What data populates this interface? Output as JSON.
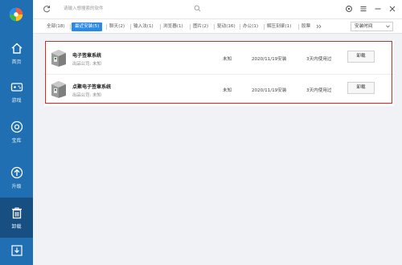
{
  "colors": {
    "sidebar": "#1f6fb2",
    "sidebar_active": "#174f82",
    "accent": "#2b8ae6",
    "highlight": "#e02424"
  },
  "sidebar": {
    "items": [
      {
        "label": "首页",
        "icon": "home-icon"
      },
      {
        "label": "游戏",
        "icon": "gamepad-icon"
      },
      {
        "label": "宝库",
        "icon": "treasure-icon"
      },
      {
        "label": "升级",
        "icon": "upgrade-icon"
      },
      {
        "label": "卸载",
        "icon": "uninstall-icon",
        "active": true
      },
      {
        "label": "",
        "icon": "download-icon"
      }
    ]
  },
  "search": {
    "placeholder": "请输入想搜索的软件"
  },
  "tabs": [
    {
      "label": "全部(18)"
    },
    {
      "label": "最近安装(5)",
      "active": true
    },
    {
      "label": "聊天(2)"
    },
    {
      "label": "输入法(1)"
    },
    {
      "label": "浏览器(1)"
    },
    {
      "label": "图片(2)"
    },
    {
      "label": "驱动(16)"
    },
    {
      "label": "办公(1)"
    },
    {
      "label": "解压刻录(1)"
    },
    {
      "label": "股票"
    }
  ],
  "sort": {
    "label": "安装时间"
  },
  "apps": [
    {
      "name": "电子签章系统",
      "publisher": "出品公司: 未知",
      "size": "未知",
      "date": "2020/11/19安装",
      "usage": "3天内使用过",
      "action": "卸载"
    },
    {
      "name": "点聚电子签章系统",
      "publisher": "出品公司: 未知",
      "size": "未知",
      "date": "2020/11/19安装",
      "usage": "3天内使用过",
      "action": "卸载"
    }
  ]
}
